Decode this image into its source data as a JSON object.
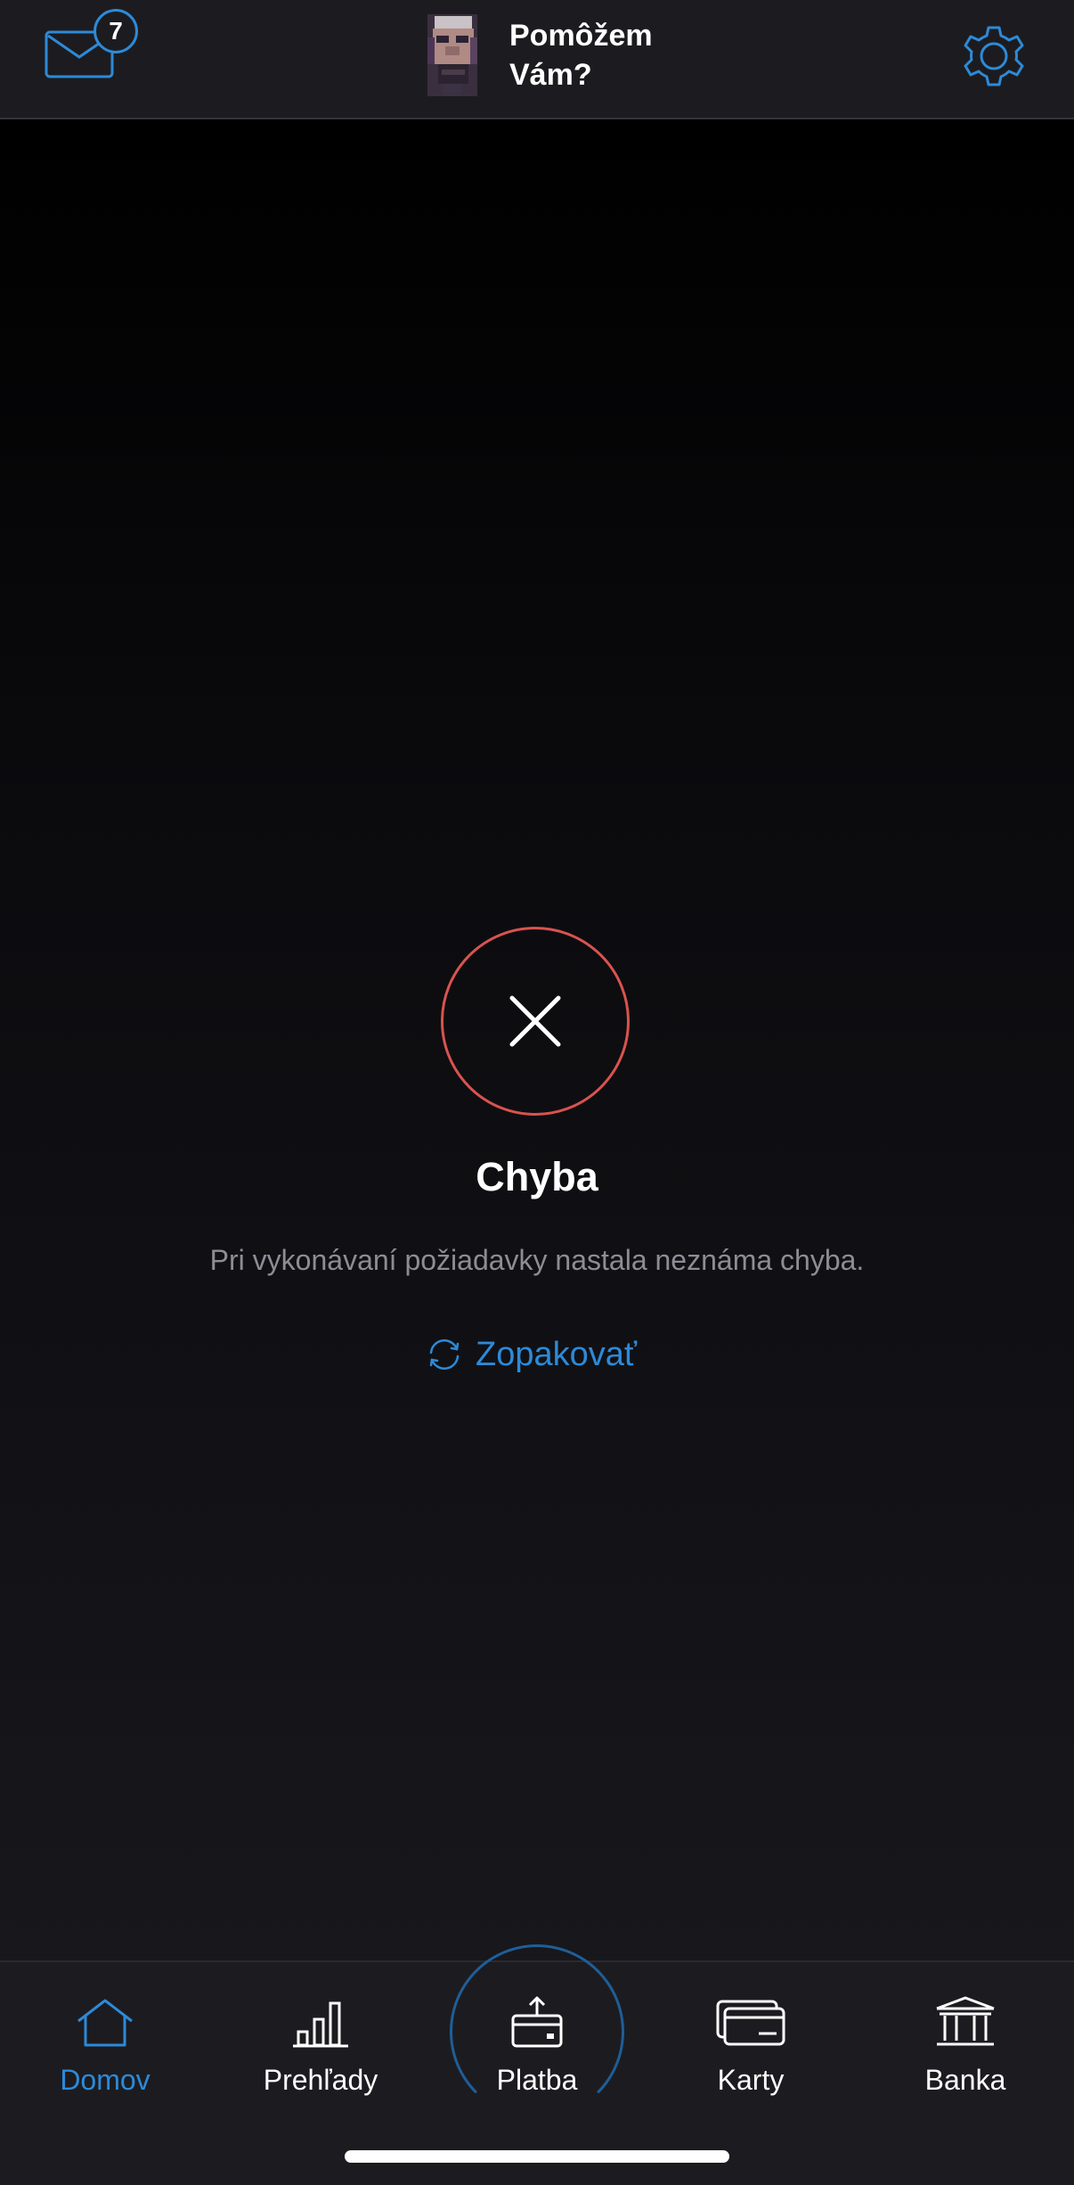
{
  "header": {
    "mail_badge_count": "7",
    "assistant_label": "Pomôžem Vám?"
  },
  "error": {
    "title": "Chyba",
    "message": "Pri vykonávaní požiadavky nastala neznáma chyba.",
    "retry_label": "Zopakovať"
  },
  "nav": {
    "items": [
      {
        "label": "Domov",
        "icon": "home-icon",
        "active": true
      },
      {
        "label": "Prehľady",
        "icon": "bar-chart-icon",
        "active": false
      },
      {
        "label": "Platba",
        "icon": "payment-icon",
        "active": false
      },
      {
        "label": "Karty",
        "icon": "cards-icon",
        "active": false
      },
      {
        "label": "Banka",
        "icon": "bank-icon",
        "active": false
      }
    ]
  },
  "colors": {
    "accent": "#2d8ad8",
    "error": "#d9534f",
    "background": "#000000",
    "bar": "#1c1c20"
  }
}
